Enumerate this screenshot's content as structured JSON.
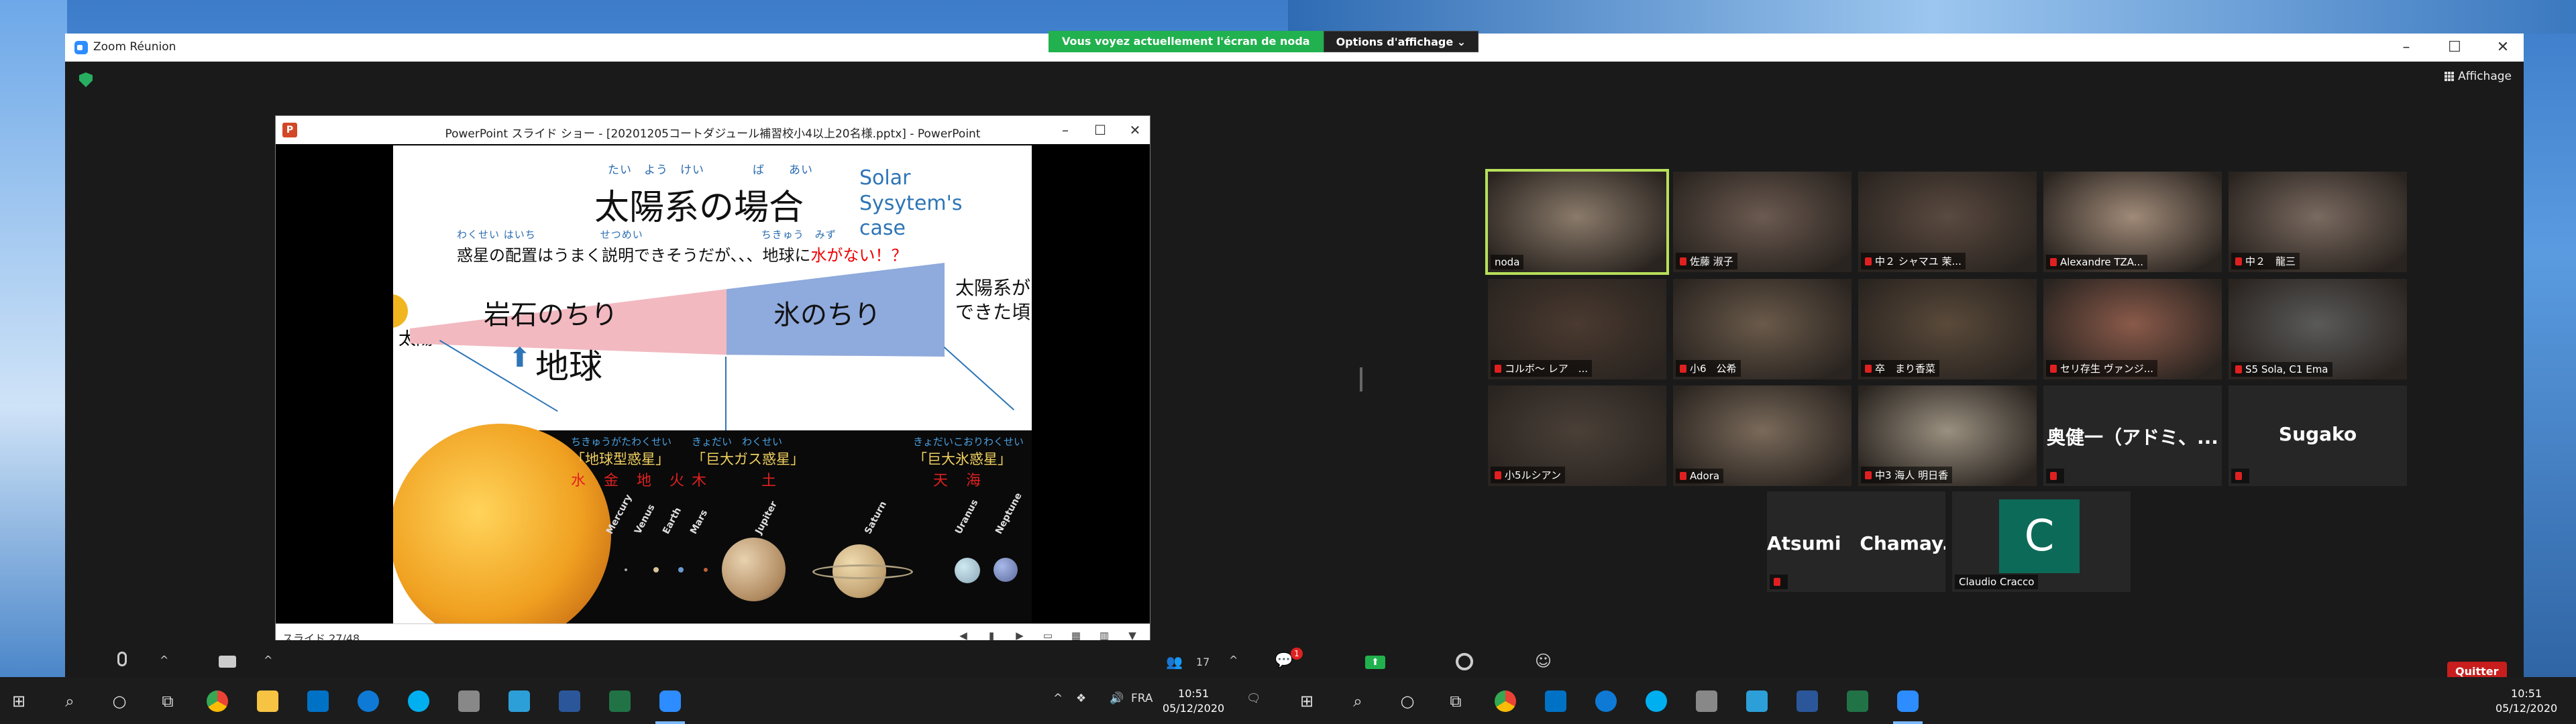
{
  "zoom": {
    "window_title": "Zoom Réunion",
    "view_label": "Affichage",
    "quit_label": "Quitter",
    "participants_count": "17",
    "chat_badge": "1"
  },
  "share_banner": {
    "message": "Vous voyez actuellement l'écran de noda",
    "options_label": "Options d'affichage ⌄"
  },
  "powerpoint": {
    "title": "PowerPoint スライド ショー - [20201205コートダジュール補習校小4以上20名様.pptx] - PowerPoint",
    "slide_counter": "スライド 27/48"
  },
  "slide": {
    "title_ruby": "たい　よう　けい　　　　ば　　あい",
    "title": "太陽系の場合",
    "title_en": "Solar Sysytem's case",
    "sub_ruby": "わくせい はいち　　　　　　せつめい　　　　　　　　　　　ちきゅう　みず",
    "sub_part1": "惑星の配置はうまく説明できそうだが、、、地球に",
    "sub_red": "水がない！？",
    "sun_label": "太陽",
    "rock_label": "岩石のちり",
    "ice_label": "氷のちり",
    "formed_label_1": "太陽系が",
    "formed_label_2": "できた頃",
    "earth_arrow": "⬆",
    "earth_label": "地球",
    "group1_ruby": "ちきゅうがたわくせい",
    "group1_name": "「地球型惑星」",
    "group1_kanji": "水 金 地 火",
    "group2_ruby": "きょだい　わくせい",
    "group2_name": "「巨大ガス惑星」",
    "group2_kanji": "木　　　土",
    "group3_ruby": "きょだいこおりわくせい",
    "group3_name": "「巨大氷惑星」",
    "group3_kanji": "天 海",
    "planets": [
      "Mercury",
      "Venus",
      "Earth",
      "Mars",
      "Jupiter",
      "Saturn",
      "Uranus",
      "Neptune"
    ]
  },
  "participants": [
    {
      "name": "noda",
      "muted": false,
      "active": true,
      "color": "#8a7a6a"
    },
    {
      "name": "佐藤 淑子",
      "muted": true,
      "color": "#6b5a50"
    },
    {
      "name": "中２ シャマユ 茉...",
      "muted": true,
      "color": "#5a4a40"
    },
    {
      "name": "Alexandre TZA...",
      "muted": true,
      "color": "#a08a78"
    },
    {
      "name": "中２　龍三",
      "muted": true,
      "color": "#7a6a60"
    },
    {
      "name": "コルボ〜 レア　...",
      "muted": true,
      "color": "#4a3a30"
    },
    {
      "name": "小6　公希",
      "muted": true,
      "color": "#6a5a4a"
    },
    {
      "name": "卒　まり香菜",
      "muted": true,
      "color": "#5a4a3a"
    },
    {
      "name": "セリ存生 ヴァンジ...",
      "muted": true,
      "color": "#8a5a4a"
    },
    {
      "name": "S5 Sola, C1 Ema",
      "muted": true,
      "color": "#5a5a5a"
    },
    {
      "name": "小5ルシアン",
      "muted": true,
      "color": "#4a4038"
    },
    {
      "name": "Adora",
      "muted": true,
      "color": "#7a6a5a"
    },
    {
      "name": "中3 海人 明日香",
      "muted": true,
      "color": "#9a9080"
    },
    {
      "name": "奥健一（アドミ、...",
      "muted": true,
      "text_only": true
    },
    {
      "name": "Sugako",
      "muted": true,
      "text_only": true
    },
    {
      "name": "Atsumi　Chamay...",
      "muted": true,
      "text_only": true
    },
    {
      "name": "Claudio Cracco",
      "muted": false,
      "avatar": "C"
    }
  ],
  "taskbar": {
    "lang": "FRA",
    "time": "10:51",
    "date": "05/12/2020"
  },
  "colors": {
    "share_green": "#21b14e",
    "active_speaker": "#b8e05a",
    "quit_red": "#c81e1e"
  }
}
